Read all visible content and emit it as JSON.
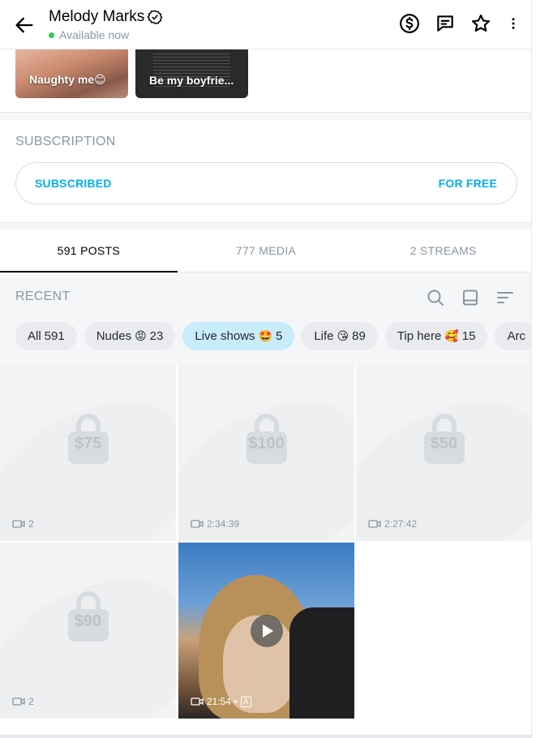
{
  "header": {
    "name": "Melody Marks",
    "status": "Available now",
    "icons": [
      "back-arrow-icon",
      "verified-icon",
      "tip-dollar-icon",
      "message-icon",
      "star-icon",
      "more-icon"
    ]
  },
  "highlights": [
    {
      "label": "Naughty me😊"
    },
    {
      "label": "Be my boyfrie..."
    }
  ],
  "subscription": {
    "title": "SUBSCRIPTION",
    "status": "SUBSCRIBED",
    "price": "FOR FREE"
  },
  "tabs": [
    {
      "label": "591 POSTS",
      "active": true
    },
    {
      "label": "777 MEDIA"
    },
    {
      "label": "2 STREAMS"
    }
  ],
  "recent": {
    "title": "RECENT",
    "filters": [
      {
        "label": "All",
        "count": "591"
      },
      {
        "label": "Nudes",
        "emoji": "😡",
        "count": "23"
      },
      {
        "label": "Live shows",
        "emoji": "🤩",
        "count": "5",
        "active": true
      },
      {
        "label": "Life",
        "emoji": "😘",
        "count": "89"
      },
      {
        "label": "Tip here",
        "emoji": "🥰",
        "count": "15"
      },
      {
        "label": "Arc"
      }
    ]
  },
  "media": [
    {
      "price": "$75",
      "meta": "2",
      "type": "video"
    },
    {
      "price": "$100",
      "meta": "2:34:39",
      "type": "video"
    },
    {
      "price": "$50",
      "meta": "2:27:42",
      "type": "video"
    },
    {
      "price": "$90",
      "meta": "2",
      "type": "video"
    },
    {
      "meta": "21:54 •",
      "badge": "A",
      "type": "video-unlocked"
    }
  ],
  "colors": {
    "accent": "#00aff0",
    "muted": "#8a96a3",
    "chip_active": "#c9ecfb"
  }
}
